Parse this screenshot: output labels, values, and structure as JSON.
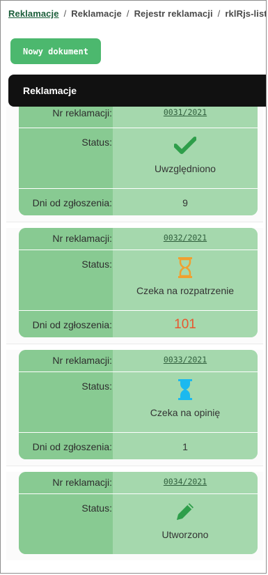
{
  "breadcrumb": {
    "items": [
      "Reklamacje",
      "Reklamacje",
      "Rejestr reklamacji",
      "rklRjs-lista"
    ],
    "separator": "/"
  },
  "toolbar": {
    "new_document_label": "Nowy dokument"
  },
  "panel": {
    "title": "Reklamacje"
  },
  "labels": {
    "nr": "Nr reklamacji:",
    "status": "Status:",
    "days": "Dni od zgłoszenia:"
  },
  "records": [
    {
      "nr": "0031/2021",
      "status": "Uwzględniono",
      "status_icon": "check-icon",
      "days": "9"
    },
    {
      "nr": "0032/2021",
      "status": "Czeka na rozpatrzenie",
      "status_icon": "hourglass-outline-icon",
      "days": "101"
    },
    {
      "nr": "0033/2021",
      "status": "Czeka na opinię",
      "status_icon": "hourglass-filled-icon",
      "days": "1"
    },
    {
      "nr": "0034/2021",
      "status": "Utworzono",
      "status_icon": "pencil-icon"
    }
  ],
  "colors": {
    "accent_green": "#4cb86e",
    "check_green": "#2e9e4a",
    "hourglass_orange": "#f0a030",
    "hourglass_cyan": "#1bb9ef",
    "overdue_red": "#e8572e"
  }
}
